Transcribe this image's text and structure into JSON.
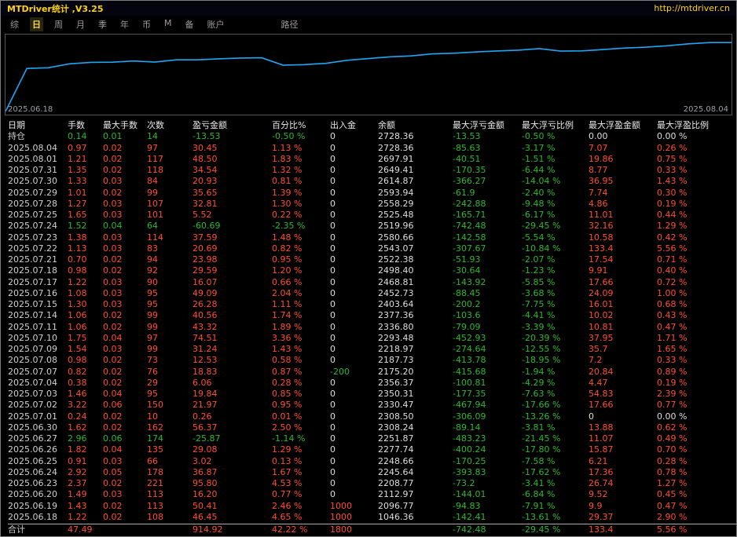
{
  "window": {
    "title": "MTDriver统计 ,V3.25",
    "url": "http://mtdriver.cn"
  },
  "menubar": {
    "tabs": [
      "综",
      "日",
      "周",
      "月",
      "季",
      "年",
      "币",
      "M",
      "备",
      "账户"
    ],
    "active": "日",
    "path": "路径"
  },
  "chart": {
    "type": "line",
    "start_date": "2025.06.18",
    "end_date": "2025.08.04",
    "balances": [
      1046.36,
      2096.77,
      2112.97,
      2208.77,
      2245.64,
      2248.66,
      2277.74,
      2251.87,
      2308.24,
      2308.5,
      2330.47,
      2350.31,
      2356.37,
      2175.2,
      2187.73,
      2218.97,
      2293.48,
      2336.8,
      2377.36,
      2403.64,
      2452.73,
      2468.81,
      2498.4,
      2522.38,
      2543.07,
      2580.66,
      2519.96,
      2525.48,
      2558.29,
      2593.94,
      2614.87,
      2649.41,
      2697.91,
      2728.36,
      2728.36
    ]
  },
  "colors": {
    "profit": "#ff4f30",
    "loss": "#2db82d",
    "neutral": "#dfdfdf",
    "date": "#d0d0d0",
    "chart_line": "#1ea6f5",
    "accent_yellow": "#ffd400"
  },
  "table": {
    "headers": [
      "日期",
      "手数",
      "最大手数",
      "次数",
      "盈亏金额",
      "百分比%",
      "出入金",
      "余额",
      "最大浮亏金额",
      "最大浮亏比例",
      "最大浮盈金额",
      "最大浮盈比例"
    ],
    "rows": [
      [
        "持仓",
        "0.14",
        "0.01",
        "14",
        "-13.53",
        "-0.50 %",
        "0",
        "2728.36",
        "-13.53",
        "-0.50 %",
        "0.00",
        "0.00 %"
      ],
      [
        "2025.08.04",
        "0.97",
        "0.02",
        "97",
        "30.45",
        "1.13 %",
        "0",
        "2728.36",
        "-85.63",
        "-3.17 %",
        "7.07",
        "0.26 %"
      ],
      [
        "2025.08.01",
        "1.21",
        "0.02",
        "117",
        "48.50",
        "1.83 %",
        "0",
        "2697.91",
        "-40.51",
        "-1.51 %",
        "19.86",
        "0.75 %"
      ],
      [
        "2025.07.31",
        "1.35",
        "0.02",
        "118",
        "34.54",
        "1.32 %",
        "0",
        "2649.41",
        "-170.35",
        "-6.44 %",
        "8.77",
        "0.33 %"
      ],
      [
        "2025.07.30",
        "1.33",
        "0.03",
        "84",
        "20.93",
        "0.81 %",
        "0",
        "2614.87",
        "-366.27",
        "-14.04 %",
        "36.95",
        "1.43 %"
      ],
      [
        "2025.07.29",
        "1.01",
        "0.02",
        "99",
        "35.65",
        "1.39 %",
        "0",
        "2593.94",
        "-61.9",
        "-2.40 %",
        "7.74",
        "0.30 %"
      ],
      [
        "2025.07.28",
        "1.27",
        "0.03",
        "107",
        "32.81",
        "1.30 %",
        "0",
        "2558.29",
        "-242.88",
        "-9.48 %",
        "4.86",
        "0.19 %"
      ],
      [
        "2025.07.25",
        "1.65",
        "0.03",
        "101",
        "5.52",
        "0.22 %",
        "0",
        "2525.48",
        "-165.71",
        "-6.17 %",
        "11.01",
        "0.44 %"
      ],
      [
        "2025.07.24",
        "1.52",
        "0.04",
        "64",
        "-60.69",
        "-2.35 %",
        "0",
        "2519.96",
        "-742.48",
        "-29.45 %",
        "32.16",
        "1.29 %"
      ],
      [
        "2025.07.23",
        "1.38",
        "0.03",
        "114",
        "37.59",
        "1.48 %",
        "0",
        "2580.66",
        "-142.58",
        "-5.54 %",
        "10.58",
        "0.42 %"
      ],
      [
        "2025.07.22",
        "1.13",
        "0.03",
        "83",
        "20.69",
        "0.82 %",
        "0",
        "2543.07",
        "-307.67",
        "-10.84 %",
        "133.4",
        "5.56 %"
      ],
      [
        "2025.07.21",
        "0.70",
        "0.02",
        "94",
        "23.98",
        "0.95 %",
        "0",
        "2522.38",
        "-51.93",
        "-2.07 %",
        "17.54",
        "0.71 %"
      ],
      [
        "2025.07.18",
        "0.98",
        "0.02",
        "92",
        "29.59",
        "1.20 %",
        "0",
        "2498.40",
        "-30.64",
        "-1.23 %",
        "9.91",
        "0.40 %"
      ],
      [
        "2025.07.17",
        "1.22",
        "0.03",
        "90",
        "16.07",
        "0.66 %",
        "0",
        "2468.81",
        "-143.92",
        "-5.85 %",
        "17.66",
        "0.72 %"
      ],
      [
        "2025.07.16",
        "1.08",
        "0.03",
        "95",
        "49.09",
        "2.04 %",
        "0",
        "2452.73",
        "-88.45",
        "-3.68 %",
        "24.09",
        "1.00 %"
      ],
      [
        "2025.07.15",
        "1.30",
        "0.03",
        "95",
        "26.28",
        "1.11 %",
        "0",
        "2403.64",
        "-200.2",
        "-7.75 %",
        "16.01",
        "0.68 %"
      ],
      [
        "2025.07.14",
        "1.06",
        "0.02",
        "99",
        "40.56",
        "1.74 %",
        "0",
        "2377.36",
        "-103.6",
        "-4.41 %",
        "10.02",
        "0.43 %"
      ],
      [
        "2025.07.11",
        "1.06",
        "0.02",
        "99",
        "43.32",
        "1.89 %",
        "0",
        "2336.80",
        "-79.09",
        "-3.39 %",
        "10.81",
        "0.47 %"
      ],
      [
        "2025.07.10",
        "1.75",
        "0.04",
        "97",
        "74.51",
        "3.36 %",
        "0",
        "2293.48",
        "-452.93",
        "-20.39 %",
        "37.95",
        "1.71 %"
      ],
      [
        "2025.07.09",
        "1.54",
        "0.03",
        "99",
        "31.24",
        "1.43 %",
        "0",
        "2218.97",
        "-274.64",
        "-12.55 %",
        "35.7",
        "1.65 %"
      ],
      [
        "2025.07.08",
        "0.98",
        "0.02",
        "73",
        "12.53",
        "0.58 %",
        "0",
        "2187.73",
        "-413.78",
        "-18.95 %",
        "7.2",
        "0.33 %"
      ],
      [
        "2025.07.07",
        "0.82",
        "0.02",
        "76",
        "18.83",
        "0.87 %",
        "-200",
        "2175.20",
        "-415.68",
        "-1.94 %",
        "20.84",
        "0.89 %"
      ],
      [
        "2025.07.04",
        "0.38",
        "0.02",
        "29",
        "6.06",
        "0.28 %",
        "0",
        "2356.37",
        "-100.81",
        "-4.29 %",
        "4.47",
        "0.19 %"
      ],
      [
        "2025.07.03",
        "1.46",
        "0.04",
        "95",
        "19.84",
        "0.85 %",
        "0",
        "2350.31",
        "-177.35",
        "-7.63 %",
        "54.83",
        "2.39 %"
      ],
      [
        "2025.07.02",
        "3.22",
        "0.06",
        "150",
        "21.97",
        "0.95 %",
        "0",
        "2330.47",
        "-467.94",
        "-17.66 %",
        "17.66",
        "0.77 %"
      ],
      [
        "2025.07.01",
        "0.24",
        "0.02",
        "10",
        "0.26",
        "0.01 %",
        "0",
        "2308.50",
        "-306.09",
        "-13.26 %",
        "0",
        "0.00 %"
      ],
      [
        "2025.06.30",
        "1.62",
        "0.02",
        "162",
        "56.37",
        "2.50 %",
        "0",
        "2308.24",
        "-89.14",
        "-3.81 %",
        "13.88",
        "0.62 %"
      ],
      [
        "2025.06.27",
        "2.96",
        "0.06",
        "174",
        "-25.87",
        "-1.14 %",
        "0",
        "2251.87",
        "-483.23",
        "-21.45 %",
        "11.07",
        "0.49 %"
      ],
      [
        "2025.06.26",
        "1.82",
        "0.04",
        "135",
        "29.08",
        "1.29 %",
        "0",
        "2277.74",
        "-400.24",
        "-17.80 %",
        "15.87",
        "0.70 %"
      ],
      [
        "2025.06.25",
        "0.91",
        "0.03",
        "66",
        "3.02",
        "0.13 %",
        "0",
        "2248.66",
        "-170.25",
        "-7.58 %",
        "6.21",
        "0.28 %"
      ],
      [
        "2025.06.24",
        "2.92",
        "0.05",
        "178",
        "36.87",
        "1.67 %",
        "0",
        "2245.64",
        "-393.83",
        "-17.62 %",
        "17.36",
        "0.78 %"
      ],
      [
        "2025.06.23",
        "2.37",
        "0.02",
        "221",
        "95.80",
        "4.53 %",
        "0",
        "2208.77",
        "-73.2",
        "-3.41 %",
        "26.74",
        "1.27 %"
      ],
      [
        "2025.06.20",
        "1.49",
        "0.03",
        "113",
        "16.20",
        "0.77 %",
        "0",
        "2112.97",
        "-144.01",
        "-6.84 %",
        "9.52",
        "0.45 %"
      ],
      [
        "2025.06.19",
        "1.43",
        "0.02",
        "113",
        "50.41",
        "2.46 %",
        "1000",
        "2096.77",
        "-94.83",
        "-7.91 %",
        "9.9",
        "0.47 %"
      ],
      [
        "2025.06.18",
        "1.22",
        "0.02",
        "108",
        "46.45",
        "4.65 %",
        "1000",
        "1046.36",
        "-142.41",
        "-13.61 %",
        "29.37",
        "2.90 %"
      ]
    ],
    "total": [
      "合计",
      "47.49",
      "",
      "",
      "914.92",
      "42.22 %",
      "1800",
      "",
      "-742.48",
      "-29.45 %",
      "133.4",
      "5.56 %"
    ]
  }
}
